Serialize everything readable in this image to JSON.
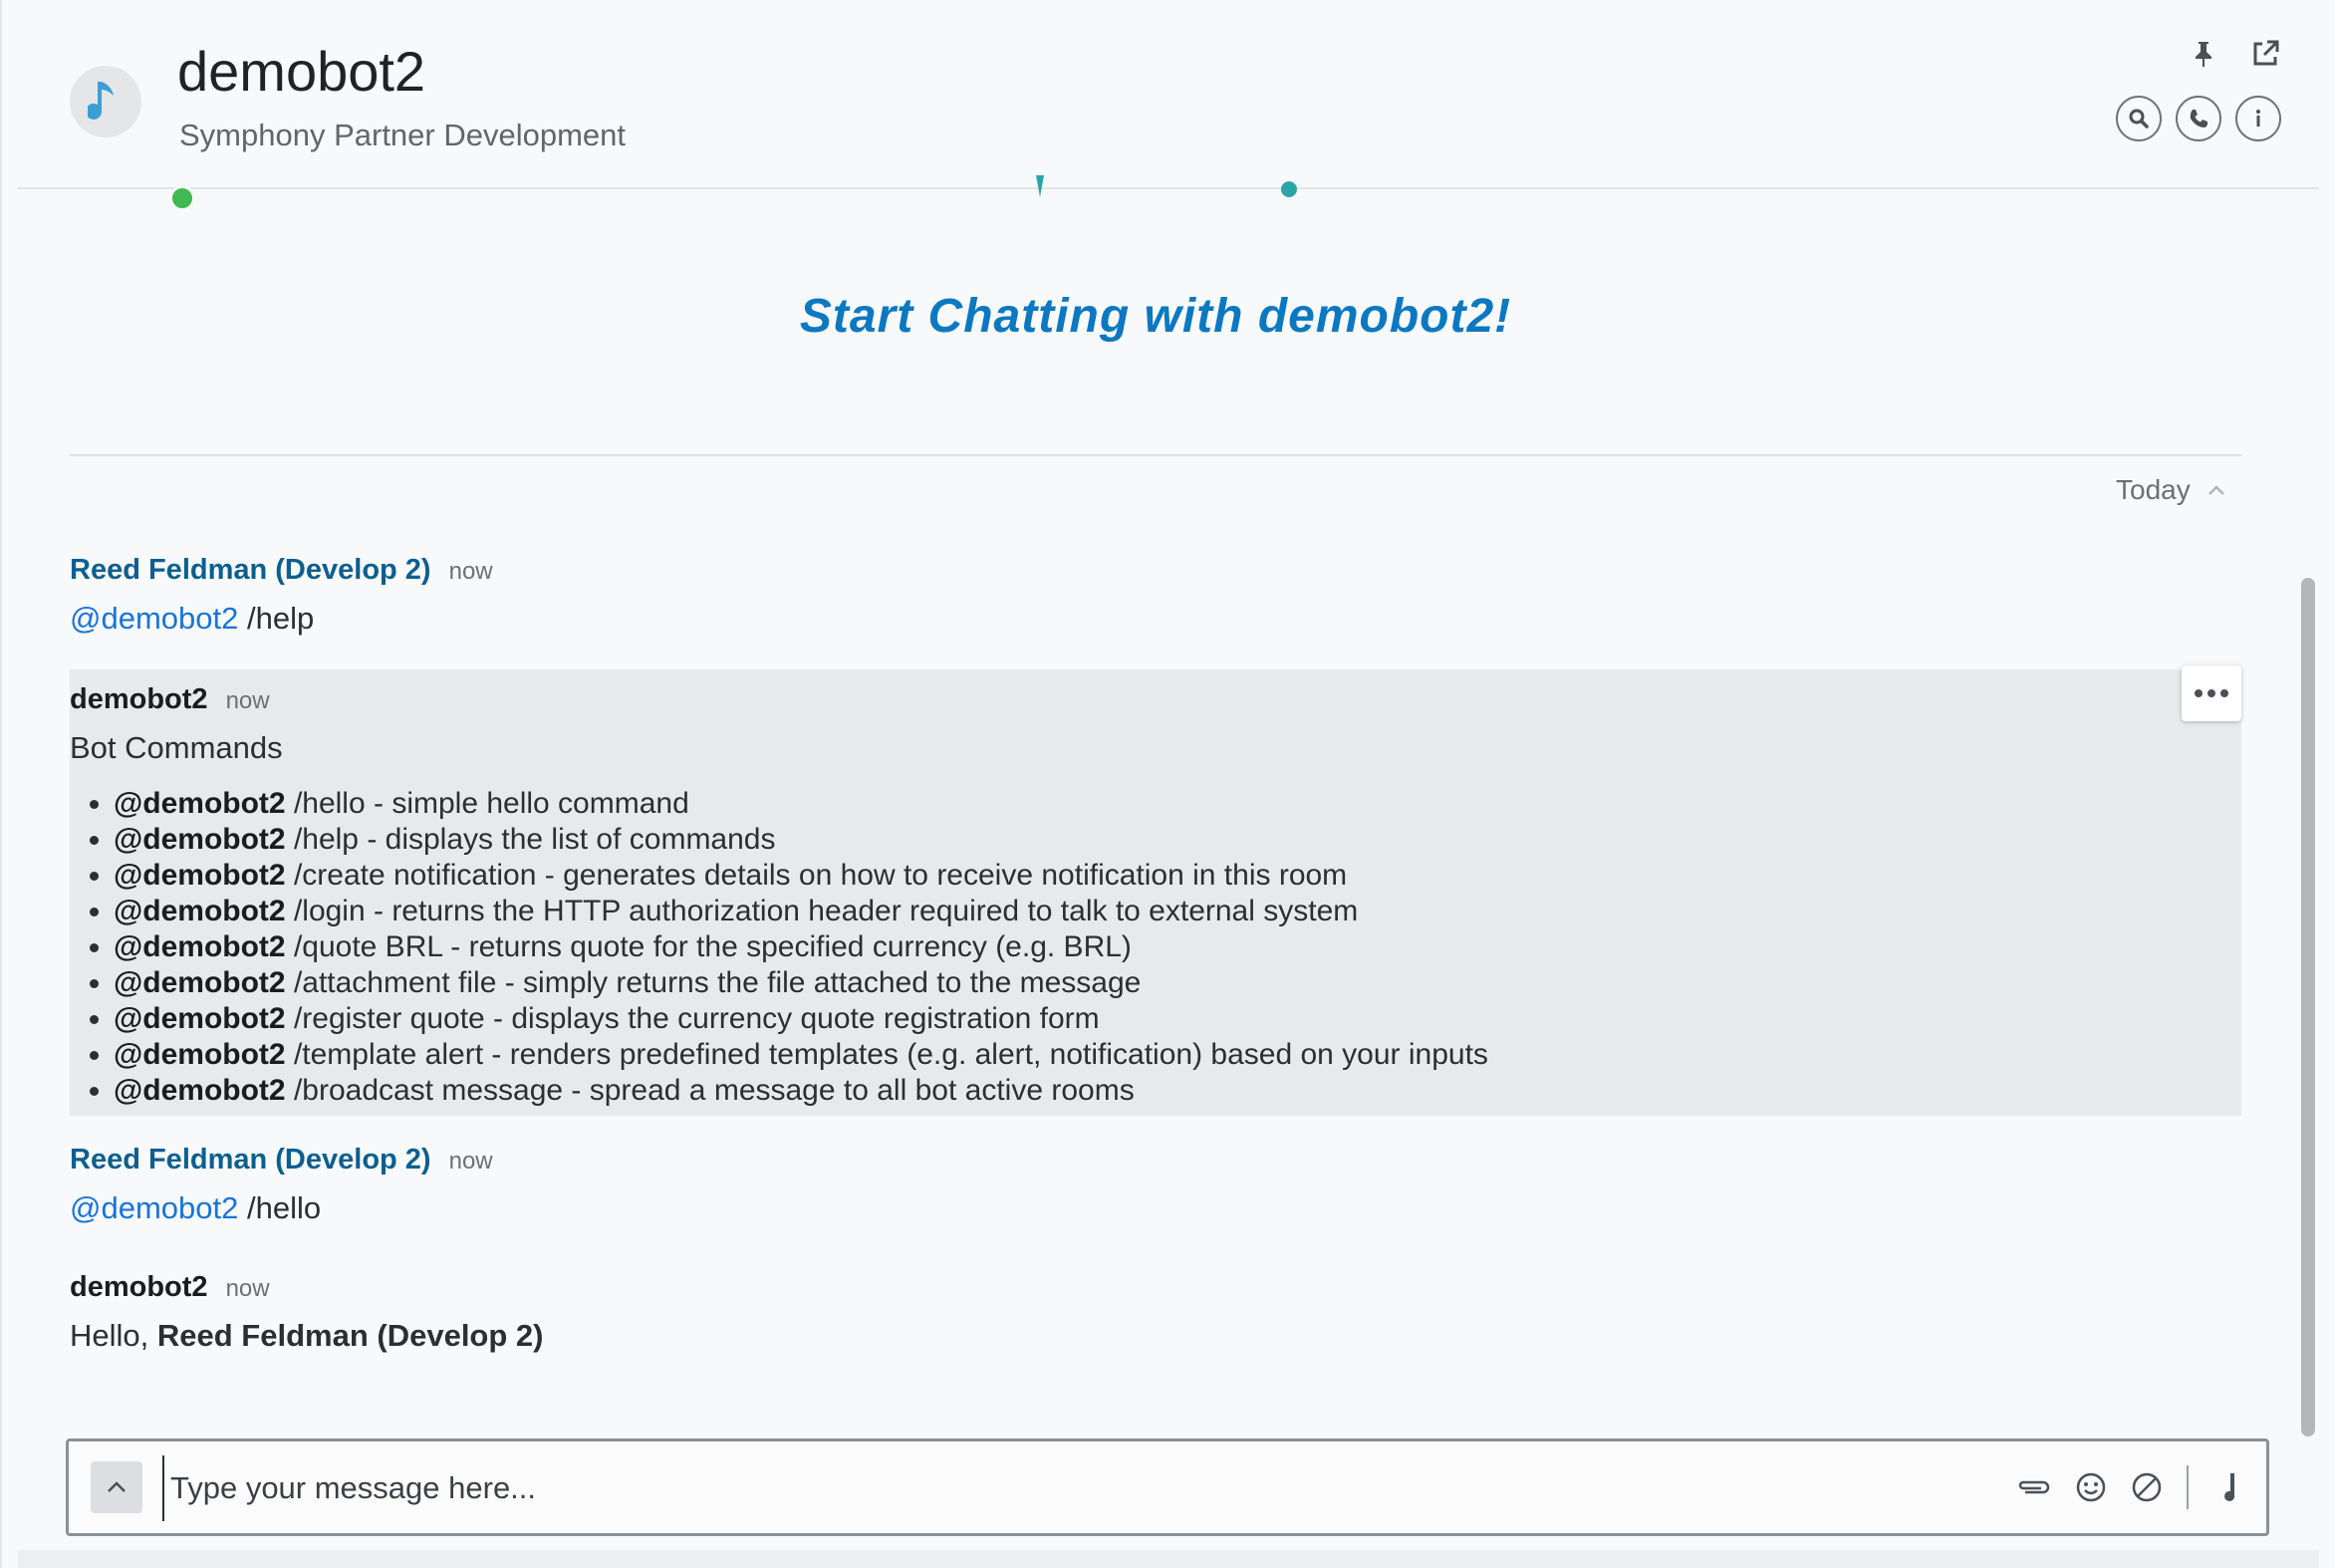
{
  "header": {
    "title": "demobot2",
    "subtitle": "Symphony Partner Development",
    "presence_color": "#3fb950",
    "icons": [
      "pin-icon",
      "popout-icon",
      "search-icon",
      "phone-icon",
      "info-icon"
    ]
  },
  "welcome": {
    "text": "Start Chatting with demobot2!"
  },
  "divider": {
    "label": "Today"
  },
  "messages": [
    {
      "sender": "Reed Feldman (Develop 2)",
      "time": "now",
      "mention": "@demobot2",
      "text": "/help"
    },
    {
      "sender": "demobot2",
      "time": "now",
      "heading": "Bot Commands",
      "commands": [
        {
          "mention": "@demobot2",
          "text": "/hello - simple hello command"
        },
        {
          "mention": "@demobot2",
          "text": "/help - displays the list of commands"
        },
        {
          "mention": "@demobot2",
          "text": "/create notification - generates details on how to receive notification in this room"
        },
        {
          "mention": "@demobot2",
          "text": "/login - returns the HTTP authorization header required to talk to external system"
        },
        {
          "mention": "@demobot2",
          "text": "/quote BRL - returns quote for the specified currency (e.g. BRL)"
        },
        {
          "mention": "@demobot2",
          "text": "/attachment file - simply returns the file attached to the message"
        },
        {
          "mention": "@demobot2",
          "text": "/register quote - displays the currency quote registration form"
        },
        {
          "mention": "@demobot2",
          "text": "/template alert - renders predefined templates (e.g. alert, notification) based on your inputs"
        },
        {
          "mention": "@demobot2",
          "text": "/broadcast message - spread a message to all bot active rooms"
        }
      ]
    },
    {
      "sender": "Reed Feldman (Develop 2)",
      "time": "now",
      "mention": "@demobot2",
      "text": "/hello"
    },
    {
      "sender": "demobot2",
      "time": "now",
      "greeting": "Hello,",
      "name": "Reed Feldman (Develop 2)"
    }
  ],
  "composer": {
    "placeholder": "Type your message here...",
    "value": ""
  },
  "colors": {
    "accent": "#0b78c2",
    "user_name": "#0b5f8f",
    "mention": "#1a73d9"
  }
}
